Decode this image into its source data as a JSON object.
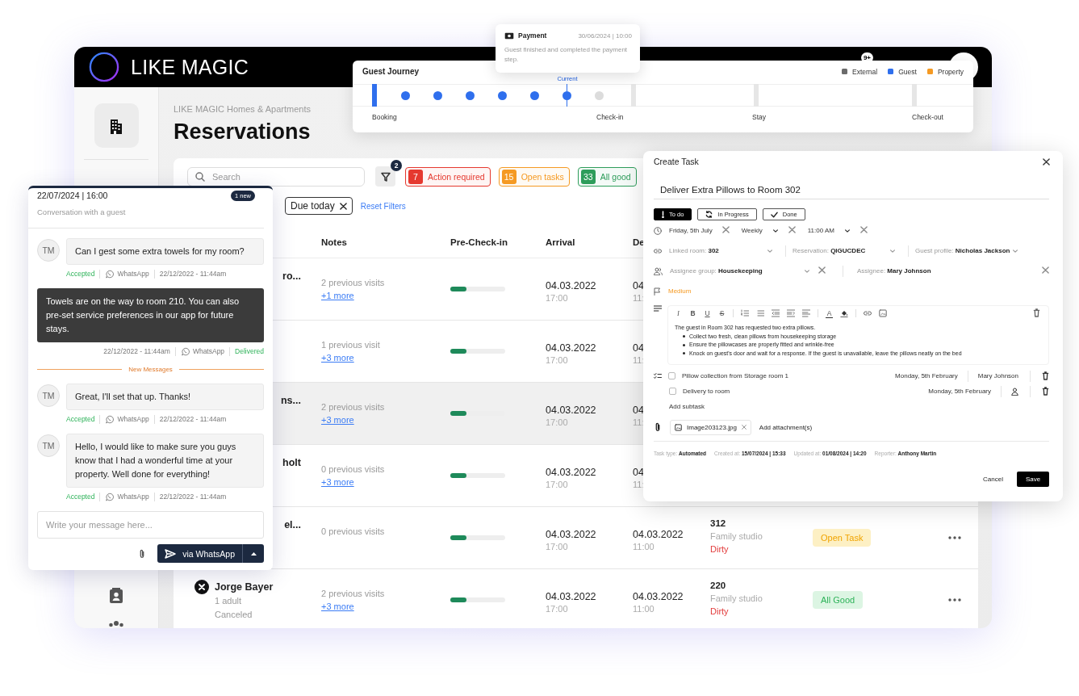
{
  "header": {
    "logo": "LIKE MAGIC",
    "notification_badge": "9+"
  },
  "page": {
    "breadcrumb": "LIKE MAGIC Homes & Apartments",
    "title": "Reservations"
  },
  "toolbar": {
    "search": {
      "placeholder": "Search"
    },
    "filter_badge": "2",
    "chips": [
      {
        "count": "7",
        "label": "Action required",
        "color": "#e5392f"
      },
      {
        "count": "15",
        "label": "Open tasks",
        "color": "#f59a23"
      },
      {
        "count": "33",
        "label": "All good",
        "color": "#2e9d5b"
      }
    ],
    "active_filters": [
      {
        "label": "Due today"
      }
    ],
    "reset": "Reset Filters"
  },
  "table": {
    "columns": [
      "Notes",
      "Pre-Check-in",
      "Arrival",
      "De"
    ],
    "rows": [
      {
        "name": "ro...",
        "covered": true,
        "highlighted": false,
        "notes": "2 previous visits",
        "more": "+1 more",
        "precheck": {
          "level": 0.3
        },
        "arrival": {
          "date": "04.03.2022",
          "time": "17:00"
        },
        "departure": {
          "date": "04",
          "time": "11:"
        }
      },
      {
        "highlighted": false,
        "notes": "1 previous visit",
        "more": "+3 more",
        "precheck": {
          "level": 0.3
        },
        "arrival": {
          "date": "04.03.2022",
          "time": "17:00"
        },
        "departure": {
          "date": "04",
          "time": "11:"
        }
      },
      {
        "name": "ns...",
        "covered": true,
        "highlighted": true,
        "notes": "2 previous visits",
        "more": "+3 more",
        "precheck": {
          "level": 0.3
        },
        "arrival": {
          "date": "04.03.2022",
          "time": "17:00"
        },
        "departure": {
          "date": "04",
          "time": "11:"
        }
      },
      {
        "name": "holt",
        "covered": true,
        "highlighted": false,
        "notes": "0 previous visits",
        "more": "+3 more",
        "precheck": {
          "level": 0.3
        },
        "arrival": {
          "date": "04.03.2022",
          "time": "17:00"
        },
        "departure": {
          "date": "04",
          "time": "11:"
        }
      },
      {
        "name": "el...",
        "covered": true,
        "highlighted": false,
        "notes": "0 previous visits",
        "precheck": {
          "level": 0.3
        },
        "arrival": {
          "date": "04.03.2022",
          "time": "17:00"
        },
        "departure": {
          "date": "04.03.2022",
          "time": "11:00"
        },
        "room": {
          "number": "312",
          "type": "Family studio",
          "state": "Dirty"
        },
        "status": {
          "kind": "open",
          "label": "Open Task"
        }
      },
      {
        "name": "Jorge Bayer",
        "covered": false,
        "guests": "1 adult",
        "state": "Canceled",
        "highlighted": false,
        "notes": "2 previous visits",
        "more": "+3 more",
        "precheck": {
          "level": 0.3
        },
        "arrival": {
          "date": "04.03.2022",
          "time": "17:00"
        },
        "departure": {
          "date": "04.03.2022",
          "time": "11:00"
        },
        "room": {
          "number": "220",
          "type": "Family studio",
          "state": "Dirty"
        },
        "status": {
          "kind": "good",
          "label": "All Good"
        }
      }
    ]
  },
  "journey": {
    "title": "Guest Journey",
    "legend": [
      {
        "label": "External",
        "color": "#6b6b6b"
      },
      {
        "label": "Guest",
        "color": "#2f6fed"
      },
      {
        "label": "Property",
        "color": "#f59a23"
      }
    ],
    "steps": [
      {
        "done": true,
        "current": false
      },
      {
        "done": true,
        "current": false
      },
      {
        "done": true,
        "current": false
      },
      {
        "done": true,
        "current": false
      },
      {
        "done": true,
        "current": false
      },
      {
        "done": false,
        "current": true
      },
      {
        "done": false,
        "current": false
      }
    ],
    "current_label": "Current",
    "stages": [
      "Booking",
      "Check-in",
      "Stay",
      "Check-out"
    ]
  },
  "tooltip": {
    "title": "Payment",
    "time": "30/06/2024 | 10:00",
    "text": "Guest finished and completed the payment step."
  },
  "chat": {
    "datetime": "22/07/2024 | 16:00",
    "badge": "1 new",
    "subtitle": "Conversation with a guest",
    "messages": [
      {
        "kind": "incoming",
        "initials": "TM",
        "text": "Can I gest some extra towels for my room?",
        "status": "Accepted",
        "channel": "WhatsApp",
        "time": "22/12/2022 - 11:44am"
      },
      {
        "kind": "outgoing",
        "text": "Towels are on the way to room 210. You can also pre-set service preferences in our app for future stays.",
        "status": "Delivered",
        "channel": "WhatsApp",
        "time": "22/12/2022 - 11:44am"
      },
      {
        "kind": "divider",
        "text": "New Messages"
      },
      {
        "kind": "incoming",
        "initials": "TM",
        "text": "Great, I'll set that up. Thanks!",
        "status": "Accepted",
        "channel": "WhatsApp",
        "time": "22/12/2022 - 11:44am"
      },
      {
        "kind": "incoming",
        "initials": "TM",
        "text": "Hello, I would like to make sure you guys know that I had a wonderful time at your property. Well done for everything!",
        "status": "Accepted",
        "channel": "WhatsApp",
        "time": "22/12/2022 - 11:44am"
      }
    ],
    "input": {
      "placeholder": "Write your message here..."
    },
    "send": "via WhatsApp"
  },
  "task": {
    "title": "Create Task",
    "name": "Deliver Extra Pillows to Room 302",
    "statuses": [
      {
        "label": "To do",
        "selected": true
      },
      {
        "label": "In Progress",
        "selected": false
      },
      {
        "label": "Done",
        "selected": false
      }
    ],
    "schedule": {
      "date": "Friday, 5th July",
      "repeat": "Weekly",
      "time": "11:00 AM"
    },
    "links": [
      "Linked room: **302**",
      "Reservation: **QIGUCDEC**",
      "Guest profile: **Nicholas Jackson**"
    ],
    "assignee_group": "Assignee group: **Housekeeping**",
    "assignee": "Assignee: **Mary Johnson**",
    "priority": "Medium",
    "format_buttons": [
      "I",
      "B",
      "U",
      "S"
    ],
    "text_color_button": "A",
    "description": {
      "intro": "The guest in Room 302 has requested two extra pillows.",
      "bullets": [
        "Collect two fresh, clean pillows from housekeeping storage",
        "Ensure the pillowcases are properly fitted and wrinkle-free",
        "Knock on guest's door and wait for a response. If the guest is unavailable, leave the pillows neatly on the bed"
      ]
    },
    "subtasks": [
      {
        "text": "Pillow collection from Storage room 1",
        "checked": false,
        "date": "Monday, 5th February",
        "assignee": "Mary Johnson"
      },
      {
        "text": "Delivery to room",
        "checked": false,
        "date": "Monday, 5th February"
      }
    ],
    "add_subtask": "Add subtask",
    "attachments": [
      "Image203123.jpg"
    ],
    "add_attachment": "Add attachment(s)",
    "meta": [
      "Task type: **Automated**",
      "Created at: **15/07/2024 | 15:33**",
      "Updated at: **01/08/2024 | 14:20**",
      "Reporter: **Anthony Martin**"
    ],
    "cancel": "Cancel",
    "save": "Save"
  }
}
